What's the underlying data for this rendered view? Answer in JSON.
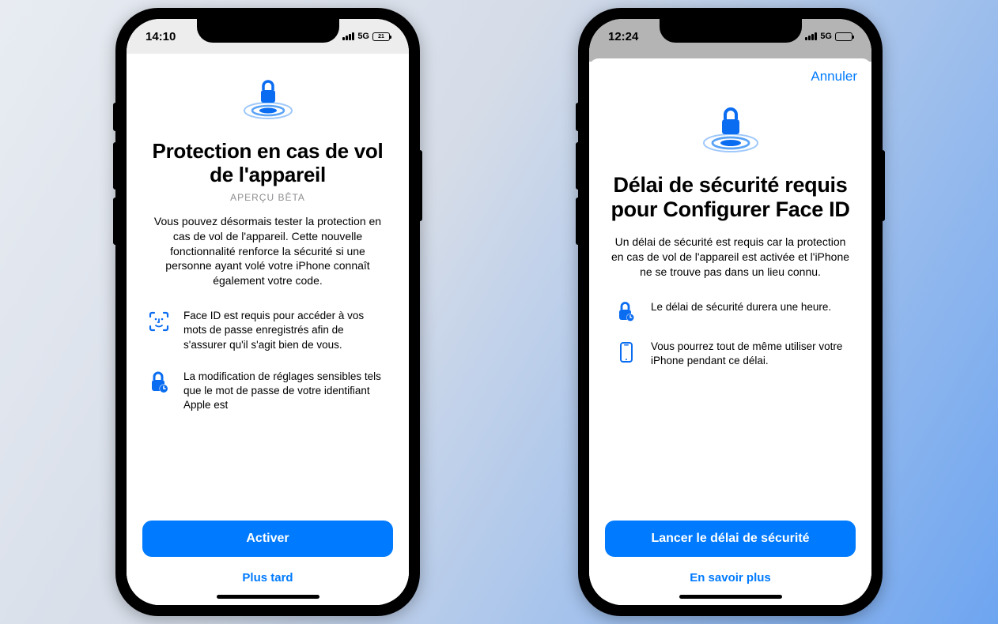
{
  "phone1": {
    "status": {
      "time": "14:10",
      "network": "5G",
      "battery": "21"
    },
    "hero_icon": "lock-ripple-icon",
    "title": "Protection en cas de vol de l'appareil",
    "subtitle": "APERÇU BÊTA",
    "description": "Vous pouvez désormais tester la protection en cas de vol de l'appareil. Cette nouvelle fonctionnalité renforce la sécurité si une personne ayant volé votre iPhone connaît également votre code.",
    "features": [
      {
        "icon": "face-id-icon",
        "text": "Face ID est requis pour accéder à vos mots de passe enregistrés afin de s'assurer qu'il s'agit bien de vous."
      },
      {
        "icon": "lock-timer-icon",
        "text": "La modification de réglages sensibles tels que le mot de passe de votre identifiant Apple est"
      }
    ],
    "primary_button": "Activer",
    "secondary_button": "Plus tard"
  },
  "phone2": {
    "status": {
      "time": "12:24",
      "network": "5G",
      "battery": " "
    },
    "cancel": "Annuler",
    "hero_icon": "lock-ripple-icon",
    "title": "Délai de sécurité requis pour Configurer Face ID",
    "description": "Un délai de sécurité est requis car la protection en cas de vol de l'appareil est activée et l'iPhone ne se trouve pas dans un lieu connu.",
    "features": [
      {
        "icon": "lock-timer-icon",
        "text": "Le délai de sécurité durera une heure."
      },
      {
        "icon": "iphone-icon",
        "text": "Vous pourrez tout de même utiliser votre iPhone pendant ce délai."
      }
    ],
    "primary_button": "Lancer le délai de sécurité",
    "secondary_button": "En savoir plus"
  }
}
